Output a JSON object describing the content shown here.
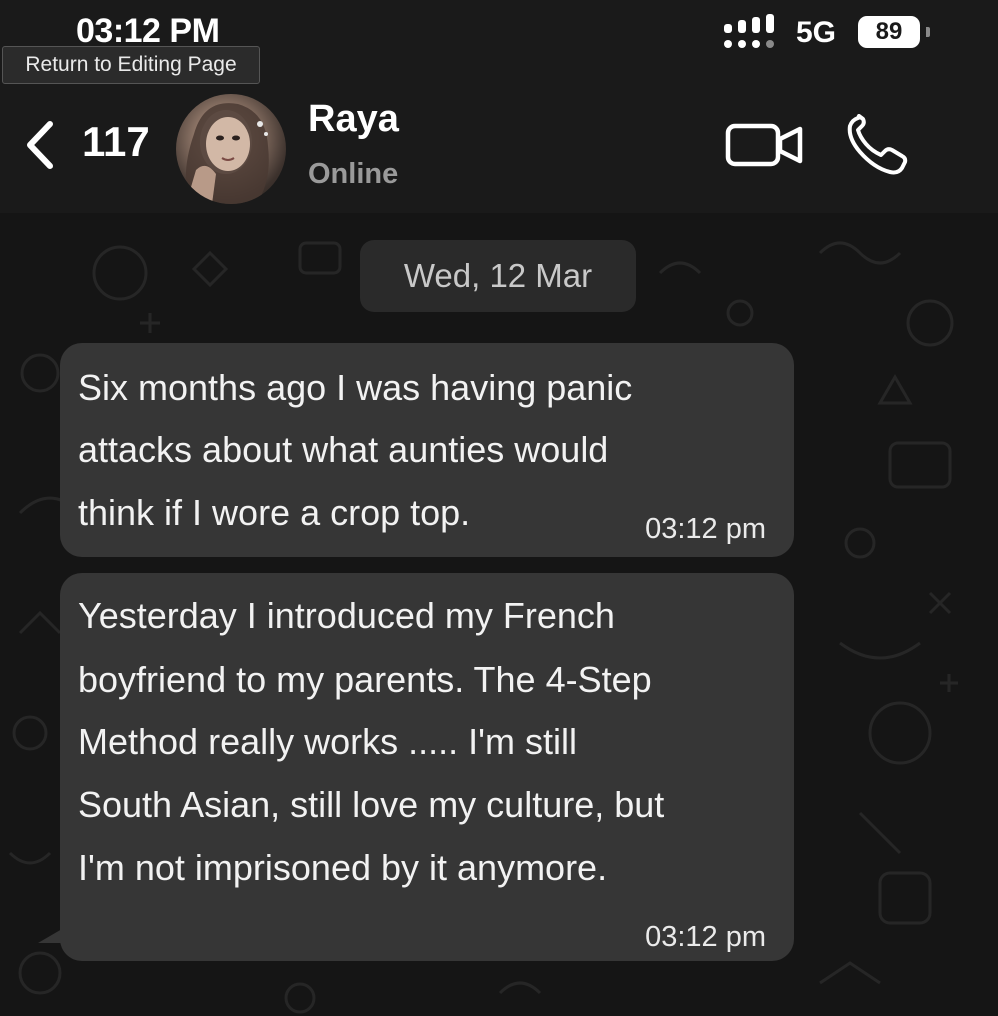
{
  "status_bar": {
    "time": "03:12 PM",
    "network": "5G",
    "battery": "89"
  },
  "tooltip": "Return to Editing Page",
  "header": {
    "unread_count": "117",
    "contact_name": "Raya",
    "presence": "Online"
  },
  "chat": {
    "date_chip": "Wed, 12 Mar",
    "messages": [
      {
        "lines": [
          " Six months ago I was having panic",
          "attacks about what aunties would",
          "think if I wore a crop top."
        ],
        "time": "03:12 pm"
      },
      {
        "lines": [
          " Yesterday I introduced my French",
          "boyfriend to my parents. The 4-Step",
          "Method really works ..... I'm still",
          "South Asian, still love my culture, but",
          "I'm not imprisoned by it anymore."
        ],
        "time": "03:12 pm"
      }
    ]
  },
  "colors": {
    "bar_background": "#1a1a1a",
    "chat_background": "#151515",
    "bubble": "#363636",
    "muted_text": "#9a9a9a"
  },
  "icons": [
    "signal-icon",
    "back-chevron-icon",
    "video-call-icon",
    "phone-icon"
  ]
}
